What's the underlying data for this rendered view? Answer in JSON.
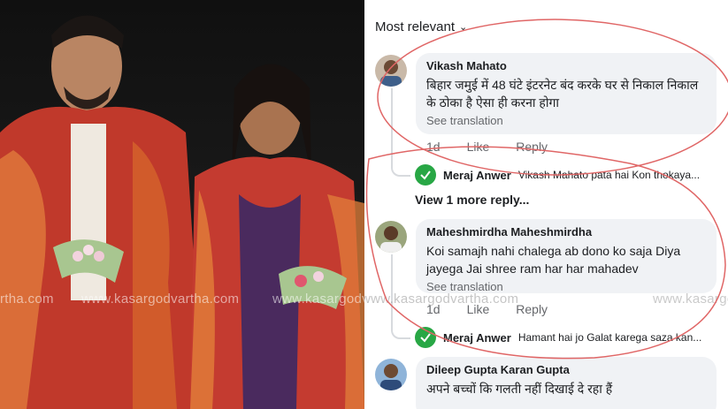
{
  "colors": {
    "circle_annotation": "#e06666",
    "bubble_bg": "#f0f2f5",
    "meta_text": "#65676b",
    "reply_avatar": "#28a745"
  },
  "watermark_text": "www.kasargodvartha.com",
  "watermark_fragment": "rtha.com",
  "filter": {
    "label": "Most relevant",
    "icon": "chevron-down-icon"
  },
  "comments": [
    {
      "author": "Vikash Mahato",
      "text": "बिहार जमुई में 48 घंटे इंटरनेट बंद करके घर से निकाल निकाल के ठोका है ऐसा ही करना होगा",
      "see_translation": "See translation",
      "time": "1d",
      "like": "Like",
      "reply": "Reply",
      "replies": [
        {
          "author": "Meraj Anwer",
          "text": "Vikash Mahato pata hai Kon thokaya..."
        }
      ],
      "view_more": "View 1 more reply..."
    },
    {
      "author": "Maheshmirdha Maheshmirdha",
      "text": "Koi samajh nahi chalega ab dono ko saja Diya jayega Jai shree ram har har mahadev",
      "see_translation": "See translation",
      "time": "1d",
      "like": "Like",
      "reply": "Reply",
      "replies": [
        {
          "author": "Meraj Anwer",
          "text": "Hamant hai jo Galat karega saza kan..."
        }
      ]
    },
    {
      "author": "Dileep Gupta Karan Gupta",
      "text": "अपने बच्चों कि गलती नहीं दिखाई दे रहा हैं"
    }
  ]
}
